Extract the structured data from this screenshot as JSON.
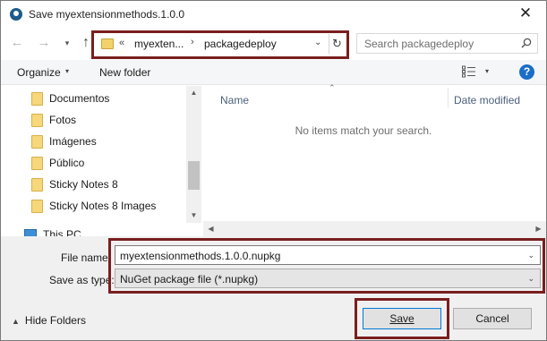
{
  "window": {
    "title": "Save myextensionmethods.1.0.0",
    "close_glyph": "✕"
  },
  "nav": {
    "back_glyph": "←",
    "forward_glyph": "→",
    "recent_glyph": "▾",
    "up_glyph": "↑",
    "address": {
      "overflow_chevrons": "«",
      "crumbs": [
        "myexten...",
        "packagedeploy"
      ],
      "separator": "›",
      "dropdown_glyph": "⌄",
      "refresh_glyph": "↻"
    },
    "search_placeholder": "Search packagedeploy"
  },
  "toolbar": {
    "organize_label": "Organize",
    "dropdown_glyph": "▾",
    "new_folder_label": "New folder",
    "help_label": "?"
  },
  "navpane": {
    "items": [
      {
        "label": "Documentos"
      },
      {
        "label": "Fotos"
      },
      {
        "label": "Imágenes"
      },
      {
        "label": "Público"
      },
      {
        "label": "Sticky Notes 8"
      },
      {
        "label": "Sticky Notes 8 Images"
      }
    ],
    "this_pc_label": "This PC"
  },
  "scroll": {
    "up_glyph": "▲",
    "down_glyph": "▼",
    "left_glyph": "◀",
    "right_glyph": "▶"
  },
  "filelist": {
    "sort_glyph": "⌃",
    "columns": [
      "Name",
      "Date modified"
    ],
    "empty_message": "No items match your search."
  },
  "form": {
    "file_name_label": "File name:",
    "file_name_value": "myextensionmethods.1.0.0.nupkg",
    "save_as_type_label": "Save as type:",
    "save_as_type_value": "NuGet package file (*.nupkg)",
    "dropdown_glyph": "⌄"
  },
  "footer": {
    "hide_folders_glyph": "▲",
    "hide_folders_label": "Hide Folders",
    "save_label": "Save",
    "cancel_label": "Cancel"
  },
  "colors": {
    "highlight_border": "#7a1e1e",
    "help_blue": "#1a6dc8",
    "folder_yellow": "#f6d77a"
  }
}
